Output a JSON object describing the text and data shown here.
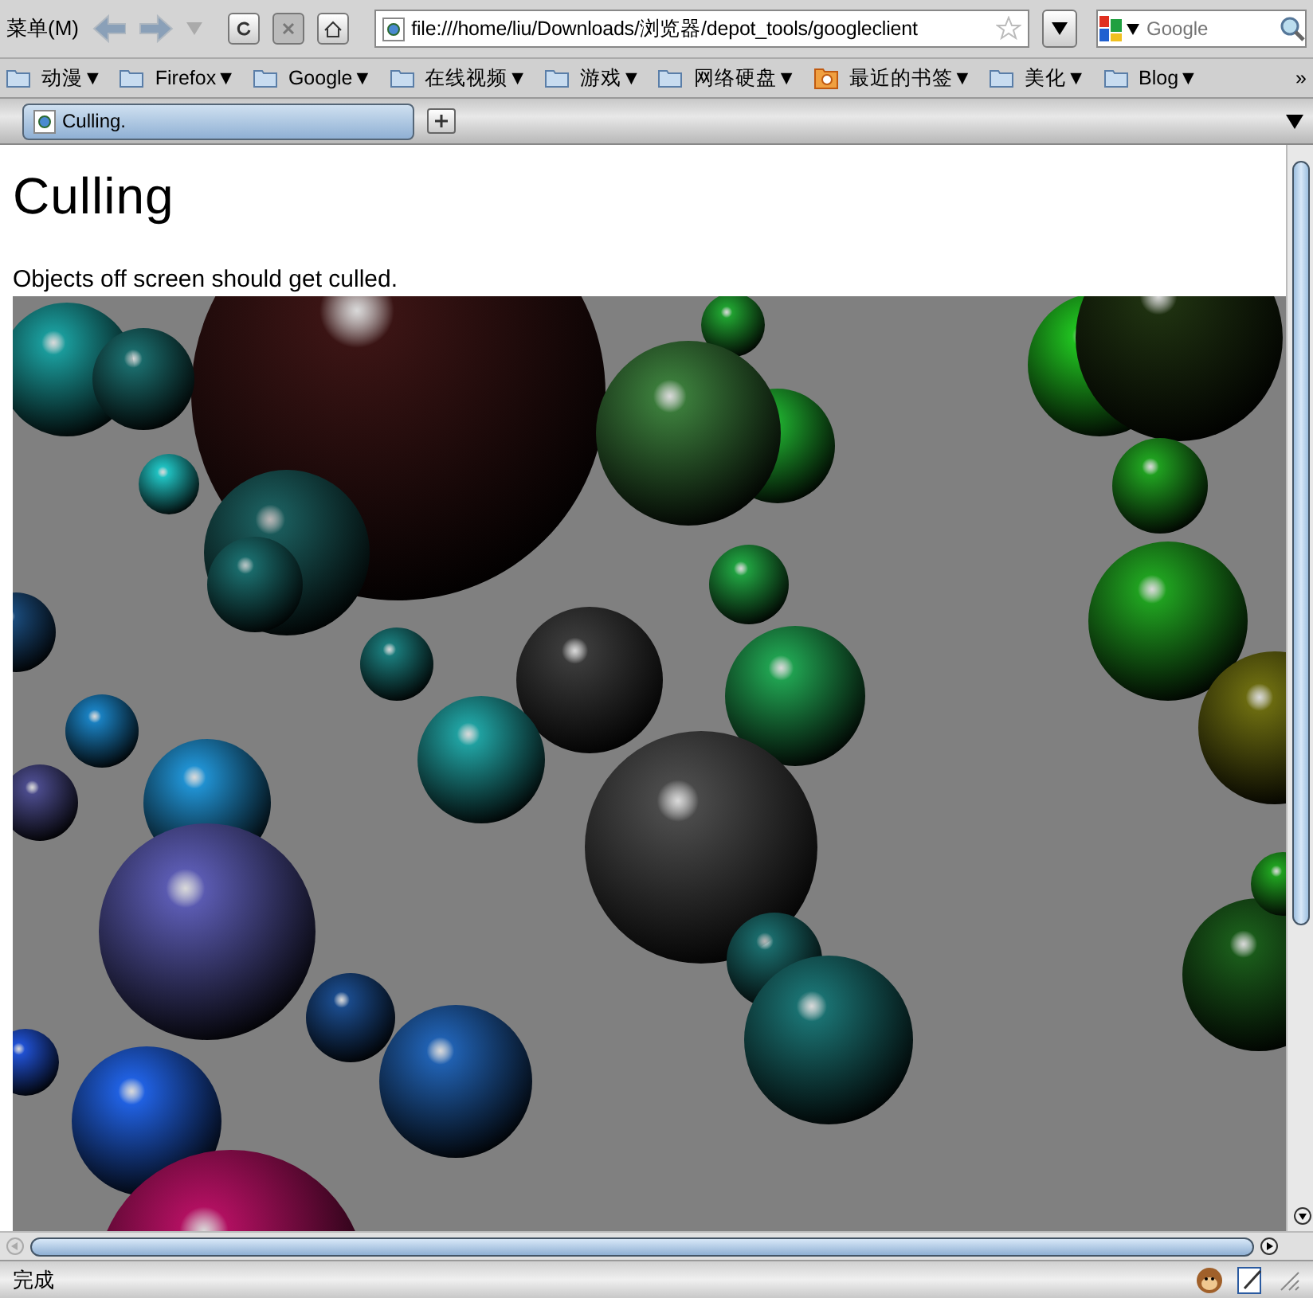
{
  "toolbar": {
    "menu": "菜单(M)",
    "url": "file:///home/liu/Downloads/浏览器/depot_tools/googleclient",
    "search_placeholder": "Google"
  },
  "bookmarks": [
    {
      "label": "动漫▼",
      "kind": "folder"
    },
    {
      "label": "Firefox▼",
      "kind": "folder"
    },
    {
      "label": "Google▼",
      "kind": "folder"
    },
    {
      "label": "在线视频▼",
      "kind": "folder"
    },
    {
      "label": "游戏▼",
      "kind": "folder"
    },
    {
      "label": "网络硬盘▼",
      "kind": "folder"
    },
    {
      "label": "最近的书签▼",
      "kind": "smart"
    },
    {
      "label": "美化▼",
      "kind": "folder"
    },
    {
      "label": "Blog▼",
      "kind": "folder"
    }
  ],
  "bookmarks_overflow": "»",
  "tabs": [
    {
      "title": "Culling.",
      "selected": true
    }
  ],
  "page": {
    "heading": "Culling",
    "text": "Objects off screen should get culled."
  },
  "status_bar": {
    "text": "完成"
  }
}
